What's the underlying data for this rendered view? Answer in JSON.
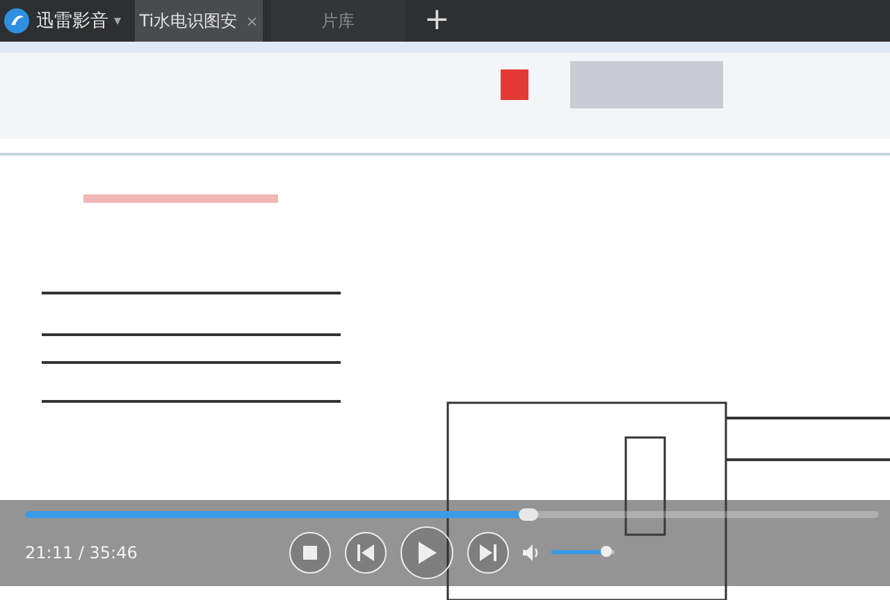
{
  "app": {
    "title": "迅雷影音",
    "menu_caret": "▾"
  },
  "tabs": [
    {
      "label": "Ti水电识图安",
      "selected": true,
      "close": "×"
    },
    {
      "label": "片库",
      "selected": false
    }
  ],
  "new_tab": "+",
  "player": {
    "progress": {
      "level": 0.59
    },
    "time": "21:11 / 35:46",
    "volume": {
      "level": 0.95
    }
  }
}
